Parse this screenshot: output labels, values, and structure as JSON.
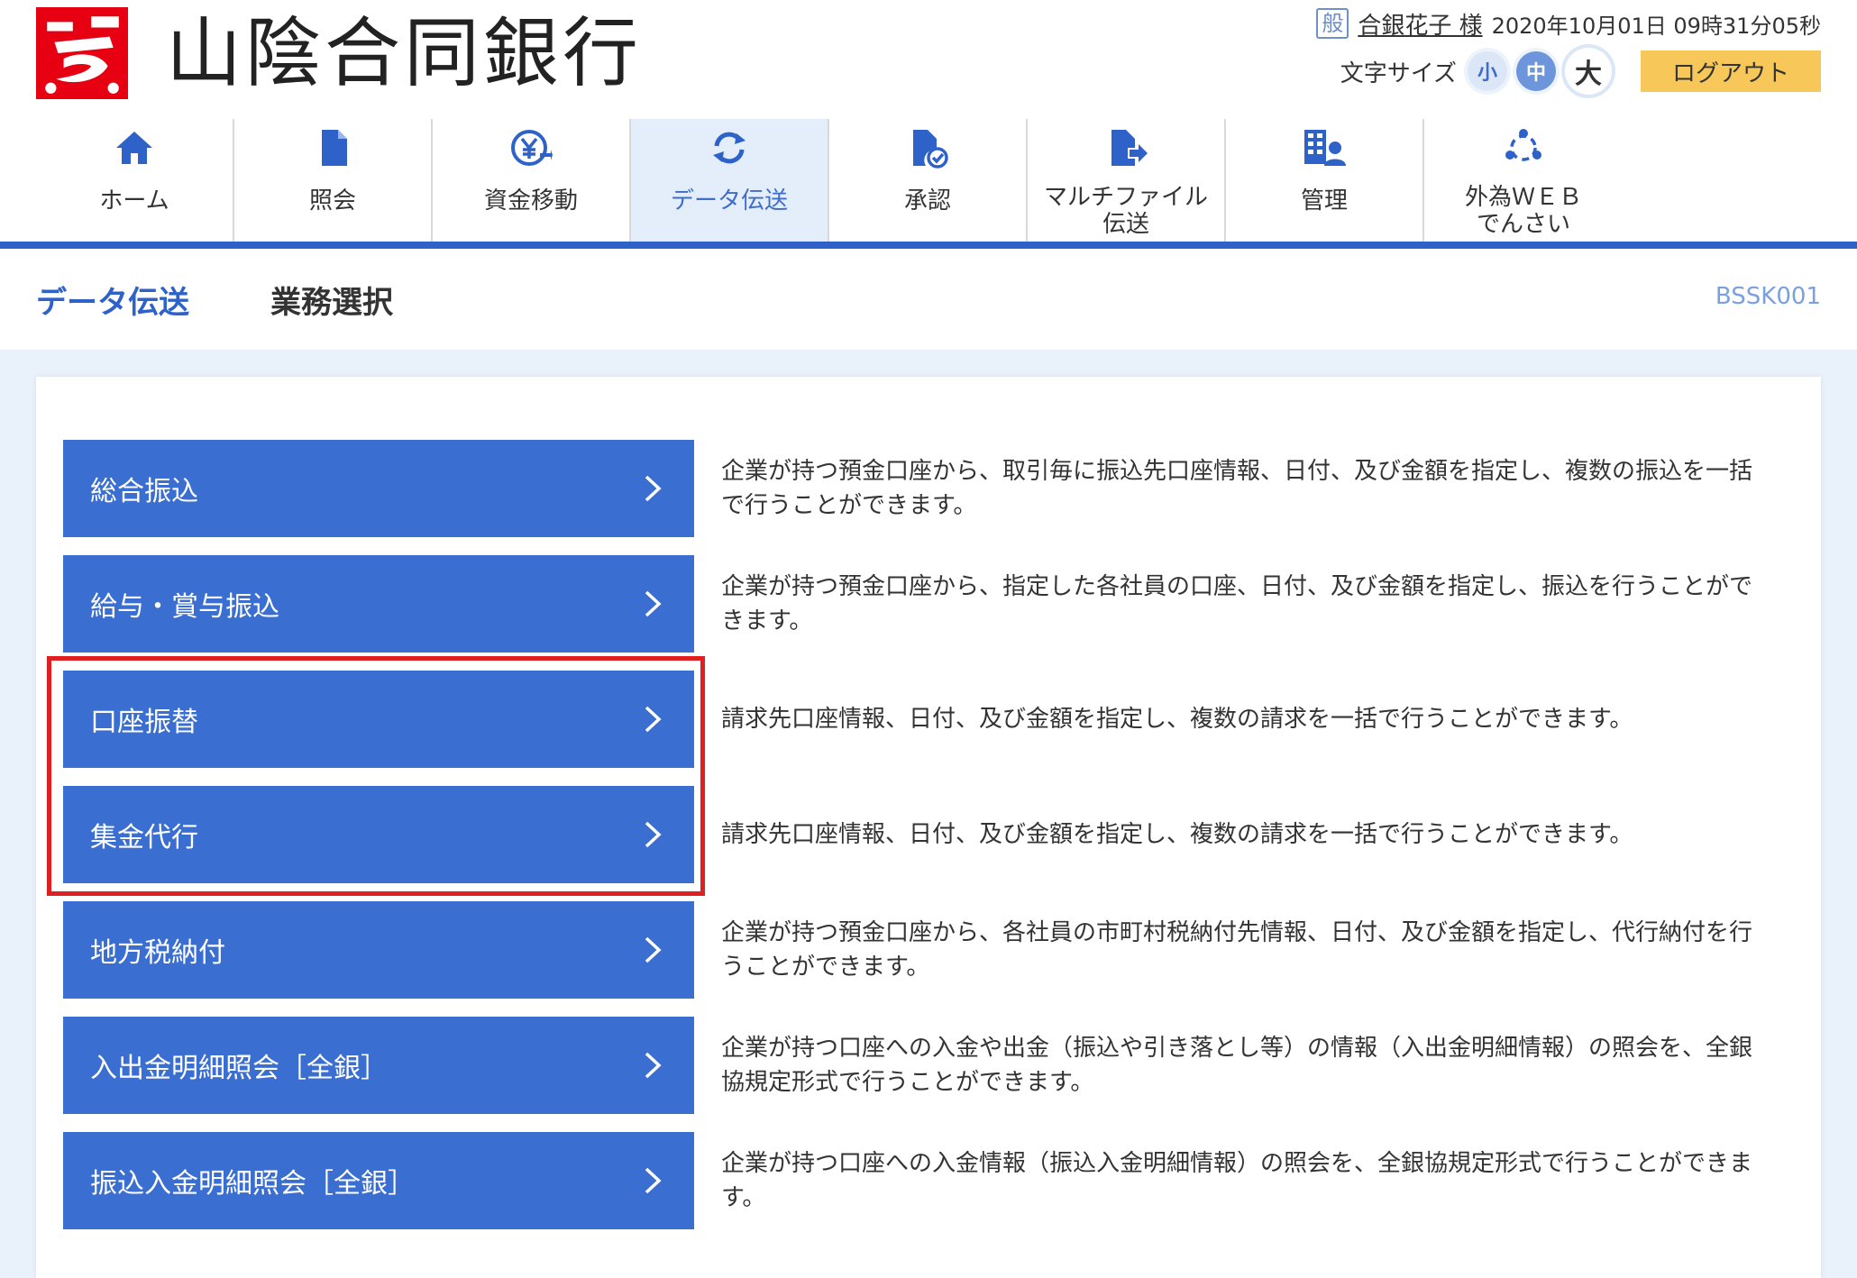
{
  "header": {
    "bank_name": "山陰合同銀行",
    "user_badge": "般",
    "user_name": "合銀花子 様",
    "datetime": "2020年10月01日 09時31分05秒",
    "font_size_label": "文字サイズ",
    "font_sizes": [
      "小",
      "中",
      "大"
    ],
    "font_size_selected": "中",
    "logout_label": "ログアウト"
  },
  "nav": {
    "active": "データ伝送",
    "items": [
      {
        "label": "ホーム",
        "icon": "home-icon"
      },
      {
        "label": "照会",
        "icon": "document-icon"
      },
      {
        "label": "資金移動",
        "icon": "yen-transfer-icon"
      },
      {
        "label": "データ伝送",
        "icon": "sync-icon"
      },
      {
        "label": "承認",
        "icon": "approve-document-icon"
      },
      {
        "label": "マルチファイル\n伝送",
        "icon": "file-send-icon"
      },
      {
        "label": "管理",
        "icon": "admin-icon"
      },
      {
        "label": "外為ＷＥＢ\nでんさい",
        "icon": "network-icon"
      }
    ]
  },
  "title_bar": {
    "section": "データ伝送",
    "page": "業務選択",
    "screen_id": "BSSK001"
  },
  "services": [
    {
      "label": "総合振込",
      "description": "企業が持つ預金口座から、取引毎に振込先口座情報、日付、及び金額を指定し、複数の振込を一括で行うことができます。"
    },
    {
      "label": "給与・賞与振込",
      "description": "企業が持つ預金口座から、指定した各社員の口座、日付、及び金額を指定し、振込を行うことができます。"
    },
    {
      "label": "口座振替",
      "description": "請求先口座情報、日付、及び金額を指定し、複数の請求を一括で行うことができます。"
    },
    {
      "label": "集金代行",
      "description": "請求先口座情報、日付、及び金額を指定し、複数の請求を一括で行うことができます。"
    },
    {
      "label": "地方税納付",
      "description": "企業が持つ預金口座から、各社員の市町村税納付先情報、日付、及び金額を指定し、代行納付を行うことができます。"
    },
    {
      "label": "入出金明細照会［全銀］",
      "description": "企業が持つ口座への入金や出金（振込や引き落とし等）の情報（入出金明細情報）の照会を、全銀協規定形式で行うことができます。"
    },
    {
      "label": "振込入金明細照会［全銀］",
      "description": "企業が持つ口座への入金情報（振込入金明細情報）の照会を、全銀協規定形式で行うことができます。"
    }
  ],
  "highlighted_services": [
    "口座振替",
    "集金代行"
  ],
  "colors": {
    "primary": "#3a6fd1",
    "nav_underline": "#2f62c9",
    "logout": "#f7c859",
    "highlight": "#e02020",
    "logo_red": "#e60012"
  }
}
